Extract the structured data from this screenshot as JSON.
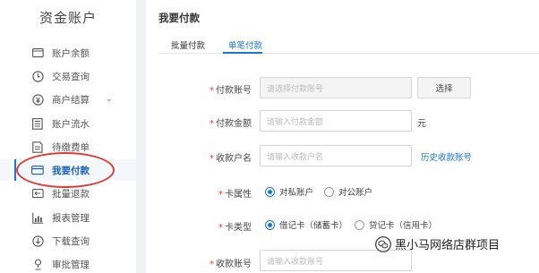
{
  "sidebar": {
    "title": "资金账户",
    "items": [
      {
        "label": "账户余额",
        "icon": "wallet-icon"
      },
      {
        "label": "交易查询",
        "icon": "clock-icon"
      },
      {
        "label": "商户结算",
        "icon": "yen-icon",
        "expandable": true
      },
      {
        "label": "账户流水",
        "icon": "ledger-icon"
      },
      {
        "label": "待缴费单",
        "icon": "bill-icon"
      },
      {
        "label": "我要付款",
        "icon": "card-icon",
        "active": true
      },
      {
        "label": "批量退款",
        "icon": "refund-icon"
      },
      {
        "label": "报表管理",
        "icon": "chart-icon"
      },
      {
        "label": "下载查询",
        "icon": "download-icon"
      },
      {
        "label": "审批管理",
        "icon": "approval-icon"
      }
    ]
  },
  "main": {
    "title": "我要付款",
    "tabs": [
      {
        "label": "批量付款",
        "active": false
      },
      {
        "label": "单笔付款",
        "active": true
      }
    ],
    "form": {
      "pay_account": {
        "label": "付款账号",
        "placeholder": "请选择付款账号",
        "button": "选择"
      },
      "amount": {
        "label": "付款金额",
        "placeholder": "请输入付款金额",
        "unit": "元"
      },
      "payee_name": {
        "label": "收款户名",
        "placeholder": "请输入收款户名",
        "link": "历史收款账号"
      },
      "account_type": {
        "label": "卡属性",
        "options": [
          "对私账户",
          "对公账户"
        ],
        "selected": 0
      },
      "card_type": {
        "label": "卡类型",
        "options": [
          "借记卡（储蓄卡）",
          "贷记卡（信用卡）"
        ],
        "selected": 0
      },
      "payee_account": {
        "label": "收款账号",
        "placeholder": "请输入收款账号"
      }
    }
  },
  "watermark": {
    "text": "黑小马网络店群项目"
  },
  "colors": {
    "accent": "#1976d2",
    "required": "#e53935",
    "annotation_circle": "#e53935"
  }
}
